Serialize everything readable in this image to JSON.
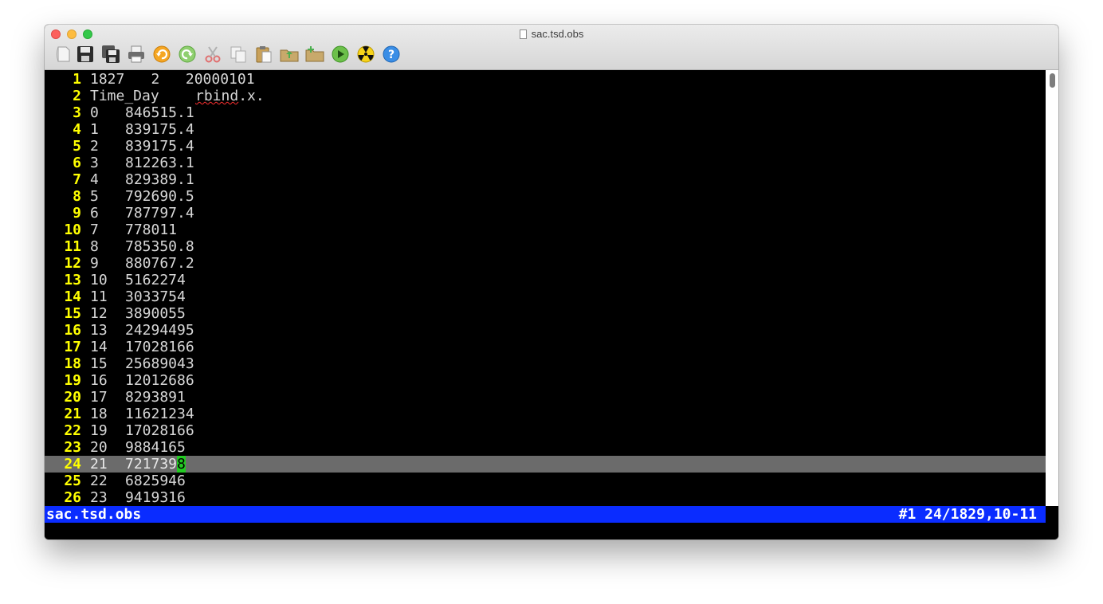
{
  "window": {
    "title": "sac.tsd.obs"
  },
  "toolbar": {
    "buttons": [
      {
        "name": "new-document-icon",
        "glyph": "▯"
      },
      {
        "name": "save-icon",
        "glyph": "💾"
      },
      {
        "name": "save-all-icon",
        "glyph": "💾"
      },
      {
        "name": "print-icon",
        "glyph": "⎙"
      },
      {
        "name": "undo-icon",
        "glyph": "↶"
      },
      {
        "name": "redo-icon",
        "glyph": "↷"
      },
      {
        "name": "cut-icon",
        "glyph": "✂"
      },
      {
        "name": "copy-icon",
        "glyph": "❐"
      },
      {
        "name": "paste-icon",
        "glyph": "📋"
      },
      {
        "name": "open-folder-icon",
        "glyph": "📂"
      },
      {
        "name": "new-folder-icon",
        "glyph": "📁"
      },
      {
        "name": "run-icon",
        "glyph": "▶"
      },
      {
        "name": "radiation-icon",
        "glyph": "☢"
      },
      {
        "name": "help-icon",
        "glyph": "?"
      }
    ]
  },
  "editor": {
    "lines": [
      {
        "num": "1",
        "c1": "1827",
        "c2": "   2   20000101"
      },
      {
        "num": "2",
        "c1": "Time_Day",
        "c2": ""
      },
      {
        "num": "3",
        "c1": "0",
        "c2": "846515.1"
      },
      {
        "num": "4",
        "c1": "1",
        "c2": "839175.4"
      },
      {
        "num": "5",
        "c1": "2",
        "c2": "839175.4"
      },
      {
        "num": "6",
        "c1": "3",
        "c2": "812263.1"
      },
      {
        "num": "7",
        "c1": "4",
        "c2": "829389.1"
      },
      {
        "num": "8",
        "c1": "5",
        "c2": "792690.5"
      },
      {
        "num": "9",
        "c1": "6",
        "c2": "787797.4"
      },
      {
        "num": "10",
        "c1": "7",
        "c2": "778011"
      },
      {
        "num": "11",
        "c1": "8",
        "c2": "785350.8"
      },
      {
        "num": "12",
        "c1": "9",
        "c2": "880767.2"
      },
      {
        "num": "13",
        "c1": "10",
        "c2": "5162274"
      },
      {
        "num": "14",
        "c1": "11",
        "c2": "3033754"
      },
      {
        "num": "15",
        "c1": "12",
        "c2": "3890055"
      },
      {
        "num": "16",
        "c1": "13",
        "c2": "24294495"
      },
      {
        "num": "17",
        "c1": "14",
        "c2": "17028166"
      },
      {
        "num": "18",
        "c1": "15",
        "c2": "25689043"
      },
      {
        "num": "19",
        "c1": "16",
        "c2": "12012686"
      },
      {
        "num": "20",
        "c1": "17",
        "c2": "8293891"
      },
      {
        "num": "21",
        "c1": "18",
        "c2": "11621234"
      },
      {
        "num": "22",
        "c1": "19",
        "c2": "17028166"
      },
      {
        "num": "23",
        "c1": "20",
        "c2": "9884165"
      },
      {
        "num": "24",
        "c1": "21",
        "c2": "721739"
      },
      {
        "num": "25",
        "c1": "22",
        "c2": "6825946"
      },
      {
        "num": "26",
        "c1": "23",
        "c2": "9419316"
      }
    ],
    "line2_spell": "rbind",
    "line2_tail": ".x.",
    "cursor_char": "8",
    "current_line_index": 23
  },
  "status": {
    "filename": "sac.tsd.obs",
    "position": "#1 24/1829,10-11"
  },
  "colors": {
    "line_number": "#ffff00",
    "statusbar": "#0a2cff",
    "cursor": "#22cc22",
    "current_line": "#6b6b6b"
  }
}
